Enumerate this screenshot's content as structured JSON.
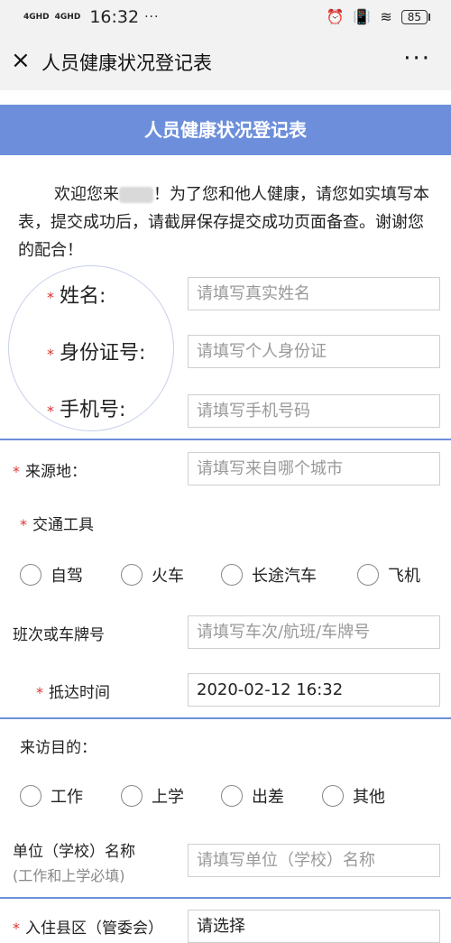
{
  "status": {
    "signal1": "4GHD",
    "signal2": "4GHD",
    "time": "16:32",
    "dots": "···",
    "battery": "85"
  },
  "nav": {
    "title": "人员健康状况登记表",
    "close_glyph": "×",
    "more_glyph": "···"
  },
  "header": {
    "title": "人员健康状况登记表"
  },
  "intro": {
    "before": "欢迎您来",
    "after": "！为了您和他人健康，请您如实填写本表，提交成功后，请截屏保存提交成功页面备查。谢谢您的配合！"
  },
  "form": {
    "name": {
      "label": "姓名:",
      "placeholder": "请填写真实姓名"
    },
    "id": {
      "label": "身份证号:",
      "placeholder": "请填写个人身份证"
    },
    "phone": {
      "label": "手机号:",
      "placeholder": "请填写手机号码"
    },
    "origin": {
      "label": "来源地：",
      "placeholder": "请填写来自哪个城市"
    },
    "transport": {
      "label": "交通工具",
      "options": [
        "自驾",
        "火车",
        "长途汽车",
        "飞机"
      ]
    },
    "trip_no": {
      "label": "班次或车牌号",
      "placeholder": "请填写车次/航班/车牌号"
    },
    "arrival": {
      "label": "抵达时间",
      "value": "2020-02-12 16:32"
    },
    "purpose": {
      "label": "来访目的：",
      "options": [
        "工作",
        "上学",
        "出差",
        "其他"
      ]
    },
    "unit": {
      "label": "单位（学校）名称",
      "hint": "(工作和上学必填)",
      "placeholder": "请填写单位（学校）名称"
    },
    "residence": {
      "label": "入住县区（管委会）",
      "placeholder": "请选择"
    }
  },
  "colors": {
    "accent": "#6d8fdb",
    "required": "#dd3333"
  }
}
